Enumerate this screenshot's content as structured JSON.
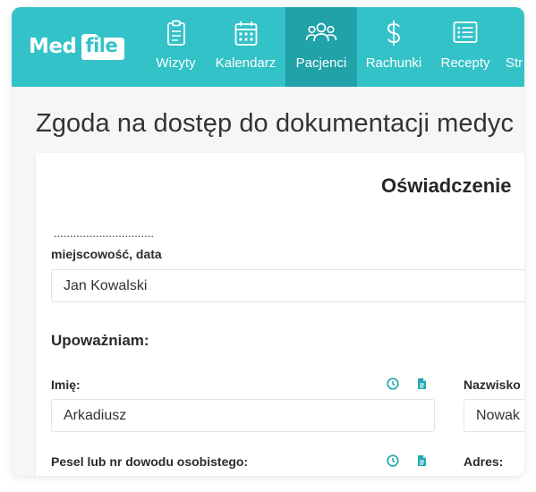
{
  "app": {
    "logo_med": "Med",
    "logo_file": "file"
  },
  "nav": {
    "items": [
      {
        "label": "Wizyty",
        "icon": "clipboard-icon"
      },
      {
        "label": "Kalendarz",
        "icon": "calendar-icon"
      },
      {
        "label": "Pacjenci",
        "icon": "users-icon",
        "active": true
      },
      {
        "label": "Rachunki",
        "icon": "dollar-icon"
      },
      {
        "label": "Recepty",
        "icon": "list-icon"
      },
      {
        "label": "Str",
        "icon": "page-icon"
      }
    ]
  },
  "page": {
    "title": "Zgoda na dostęp do dokumentacji medyc"
  },
  "form": {
    "title": "Oświadczenie",
    "dots": "...............................",
    "place_date_label": "miejscowość, data",
    "place_date_value": "Jan Kowalski",
    "authorize_label": "Upoważniam:",
    "first_name_label": "Imię:",
    "first_name_value": "Arkadiusz",
    "last_name_label": "Nazwisko",
    "last_name_value": "Nowak",
    "pesel_label": "Pesel lub nr dowodu osobistego:",
    "address_label": "Adres:"
  },
  "colors": {
    "brand": "#33c2c8",
    "brand_active": "#20a2a8",
    "icon_accent": "#26a9ae"
  }
}
